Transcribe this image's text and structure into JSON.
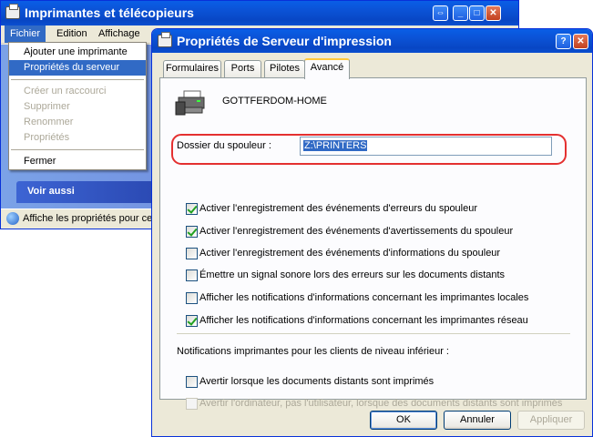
{
  "back_window": {
    "title": "Imprimantes et télécopieurs",
    "menu": [
      "Fichier",
      "Edition",
      "Affichage"
    ],
    "see_also": "Voir aussi",
    "status": "Affiche les propriétés pour ce"
  },
  "file_menu": {
    "items": [
      "Ajouter une imprimante",
      "Propriétés du serveur",
      "Créer un raccourci",
      "Supprimer",
      "Renommer",
      "Propriétés",
      "Fermer"
    ]
  },
  "dialog": {
    "title": "Propriétés de Serveur d'impression",
    "tabs": [
      "Formulaires",
      "Ports",
      "Pilotes",
      "Avancé"
    ],
    "server_name": "GOTTFERDOM-HOME",
    "spool_label": "Dossier du spouleur :",
    "spool_value": "Z:\\PRINTERS",
    "options": [
      {
        "label": "Activer l'enregistrement des événements d'erreurs du spouleur",
        "checked": true
      },
      {
        "label": "Activer l'enregistrement des événements d'avertissements du spouleur",
        "checked": true
      },
      {
        "label": "Activer l'enregistrement des événements d'informations du spouleur",
        "checked": false
      },
      {
        "label": "Émettre un signal sonore lors des erreurs sur les documents distants",
        "checked": false
      },
      {
        "label": "Afficher les notifications d'informations concernant les imprimantes locales",
        "checked": false
      },
      {
        "label": "Afficher les notifications d'informations concernant les imprimantes réseau",
        "checked": true
      }
    ],
    "downlevel_label": "Notifications imprimantes pour les clients de niveau inférieur :",
    "downlevel_options": [
      {
        "label": "Avertir lorsque les documents distants sont imprimés",
        "checked": false,
        "enabled": true
      },
      {
        "label": "Avertir l'ordinateur, pas l'utilisateur, lorsque des documents distants sont imprimés",
        "checked": false,
        "enabled": false
      }
    ],
    "buttons": [
      "OK",
      "Annuler",
      "Appliquer"
    ]
  },
  "colors": {
    "title_blue": "#0b52d5",
    "selection": "#316ac5",
    "highlight_ring": "#e43030"
  }
}
